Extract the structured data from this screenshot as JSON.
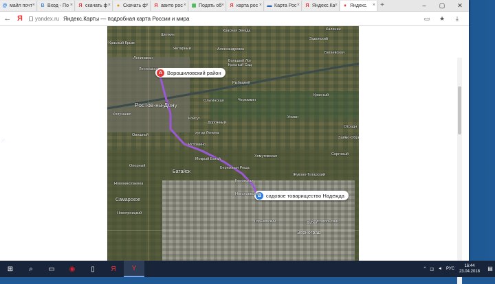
{
  "tabs": [
    {
      "label": "майл почт",
      "icon": "mail-icon",
      "color": "#1a73e8",
      "glyph": "@"
    },
    {
      "label": "Вход - По",
      "icon": "login-icon",
      "color": "#4a8bd4",
      "glyph": "В"
    },
    {
      "label": "скачать ф",
      "icon": "yandex-icon",
      "color": "#e33",
      "glyph": "Я"
    },
    {
      "label": "Скачать ф",
      "icon": "download-site-icon",
      "color": "#e88a1a",
      "glyph": "●"
    },
    {
      "label": "авито рос",
      "icon": "yandex-icon",
      "color": "#e33",
      "glyph": "Я"
    },
    {
      "label": "Подать об",
      "icon": "avito-icon",
      "color": "#3ab54a",
      "glyph": "▦"
    },
    {
      "label": "карта рос",
      "icon": "yandex-icon",
      "color": "#e33",
      "glyph": "Я"
    },
    {
      "label": "Карта Рос",
      "icon": "russia-flag-icon",
      "color": "#2b5fb4",
      "glyph": "▬"
    },
    {
      "label": "Яндекс.Ка",
      "icon": "yandex-icon",
      "color": "#e33",
      "glyph": "Я"
    },
    {
      "label": "Яндекс.",
      "icon": "maps-pin-icon",
      "color": "#e33",
      "glyph": "♦"
    }
  ],
  "address": {
    "domain": "yandex.ru",
    "title": "Яндекс.Карты — подробная карта России и мира"
  },
  "route": {
    "start_letter": "A",
    "start_label": "Ворошиловский район",
    "end_letter": "B",
    "end_label": "садовое товарищество Надежда",
    "start_color": "#e53935",
    "end_color": "#2f7de1",
    "line_color": "#9b59d6"
  },
  "map_labels": [
    {
      "text": "Ростов-на-Дону",
      "cls": "big"
    },
    {
      "text": "Батайск",
      "cls": "mid"
    },
    {
      "text": "Самарское",
      "cls": "mid"
    },
    {
      "text": "Зерноград",
      "cls": "mid"
    },
    {
      "text": "Щепкин"
    },
    {
      "text": "Красный Крым"
    },
    {
      "text": "Янтарный"
    },
    {
      "text": "Ленинаван"
    },
    {
      "text": "Ленинакан"
    },
    {
      "text": "Александровка"
    },
    {
      "text": "Красный Сад"
    },
    {
      "text": "Большой Лог"
    },
    {
      "text": "Рыбацкий"
    },
    {
      "text": "Калинин"
    },
    {
      "text": "Задонский"
    },
    {
      "text": "Багаевская"
    },
    {
      "text": "Ольгинская"
    },
    {
      "text": "Черюмкин"
    },
    {
      "text": "Красный"
    },
    {
      "text": "Усман"
    },
    {
      "text": "Койсуг"
    },
    {
      "text": "Дорожный"
    },
    {
      "text": "хутор Ленина"
    },
    {
      "text": "Истомино"
    },
    {
      "text": "Колузаево"
    },
    {
      "text": "Овощной"
    },
    {
      "text": "Мокрый Батай"
    },
    {
      "text": "Хомутовская"
    },
    {
      "text": "Березовая Роща"
    },
    {
      "text": "Кировская"
    },
    {
      "text": "Жуково-Татарский"
    },
    {
      "text": "Николаевский"
    },
    {
      "text": "Опорный"
    },
    {
      "text": "Новониколаевка"
    },
    {
      "text": "Новотроицкий"
    },
    {
      "text": "Комсомольский"
    },
    {
      "text": "Дубки"
    },
    {
      "text": "Горьковский"
    },
    {
      "text": "Отрадн"
    },
    {
      "text": "Займо-Обрыв"
    },
    {
      "text": "Сорговый"
    },
    {
      "text": "Красная Звезда"
    }
  ],
  "taskbar": {
    "language": "РУС",
    "time": "16:44",
    "date": "23.04.2018"
  }
}
